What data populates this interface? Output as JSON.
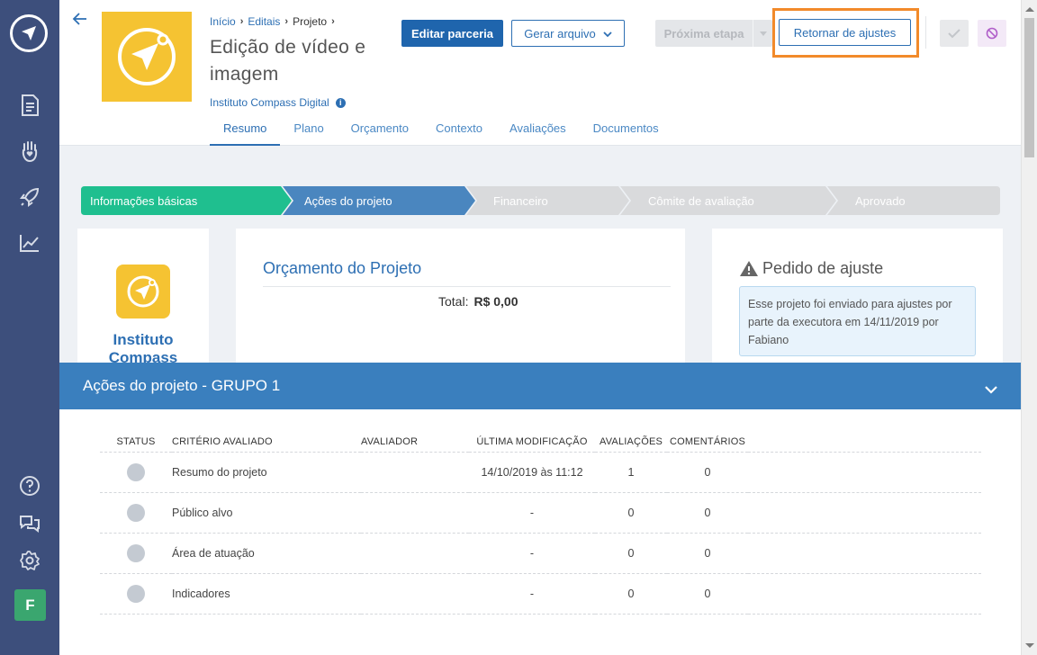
{
  "breadcrumb": {
    "home": "Início",
    "notices": "Editais",
    "project": "Projeto"
  },
  "project": {
    "title": "Edição de vídeo e imagem",
    "org": "Instituto Compass Digital"
  },
  "tabs": [
    "Resumo",
    "Plano",
    "Orçamento",
    "Contexto",
    "Avaliações",
    "Documentos"
  ],
  "toolbar": {
    "edit_label": "Editar parceria",
    "generate_label": "Gerar arquivo",
    "next_label": "Próxima etapa",
    "return_label": "Retornar de ajustes"
  },
  "steps": [
    "Informações básicas",
    "Ações do projeto",
    "Financeiro",
    "Cômite de avaliação",
    "Aprovado"
  ],
  "budget": {
    "title": "Orçamento do Projeto",
    "total_label": "Total:",
    "total_value": "R$ 0,00"
  },
  "adjust": {
    "title": "Pedido de ajuste",
    "message": "Esse projeto foi enviado para ajustes por parte da executora em 14/11/2019 por Fabiano"
  },
  "org_card": {
    "name": "Instituto Compass"
  },
  "group": {
    "title": "Ações do projeto - GRUPO 1",
    "columns": [
      "STATUS",
      "CRITÉRIO AVALIADO",
      "AVALIADOR",
      "ÚLTIMA MODIFICAÇÃO",
      "AVALIAÇÕES",
      "COMENTÁRIOS"
    ],
    "rows": [
      {
        "criterion": "Resumo do projeto",
        "evaluator": "",
        "modified": "14/10/2019 às 11:12",
        "evaluations": "1",
        "comments": "0"
      },
      {
        "criterion": "Público alvo",
        "evaluator": "",
        "modified": "-",
        "evaluations": "0",
        "comments": "0"
      },
      {
        "criterion": "Área de atuação",
        "evaluator": "",
        "modified": "-",
        "evaluations": "0",
        "comments": "0"
      },
      {
        "criterion": "Indicadores",
        "evaluator": "",
        "modified": "-",
        "evaluations": "0",
        "comments": "0"
      }
    ]
  },
  "user": {
    "initial": "F"
  },
  "colors": {
    "sidebar": "#3d4f7c",
    "primary": "#1f65ad",
    "step_done": "#1fbf8f",
    "step_active": "#4a86bf",
    "step_pending": "#d9dadc",
    "group_header": "#3a7fbe",
    "highlight": "#f28a2a",
    "logo_yellow": "#f5c332"
  },
  "icons": [
    "logo-icon",
    "document-icon",
    "hand-heart-icon",
    "rocket-icon",
    "chart-icon",
    "help-icon",
    "chat-icon",
    "gear-icon",
    "back-arrow-icon",
    "info-icon",
    "chevron-down-icon",
    "check-icon",
    "block-icon",
    "warning-icon"
  ]
}
